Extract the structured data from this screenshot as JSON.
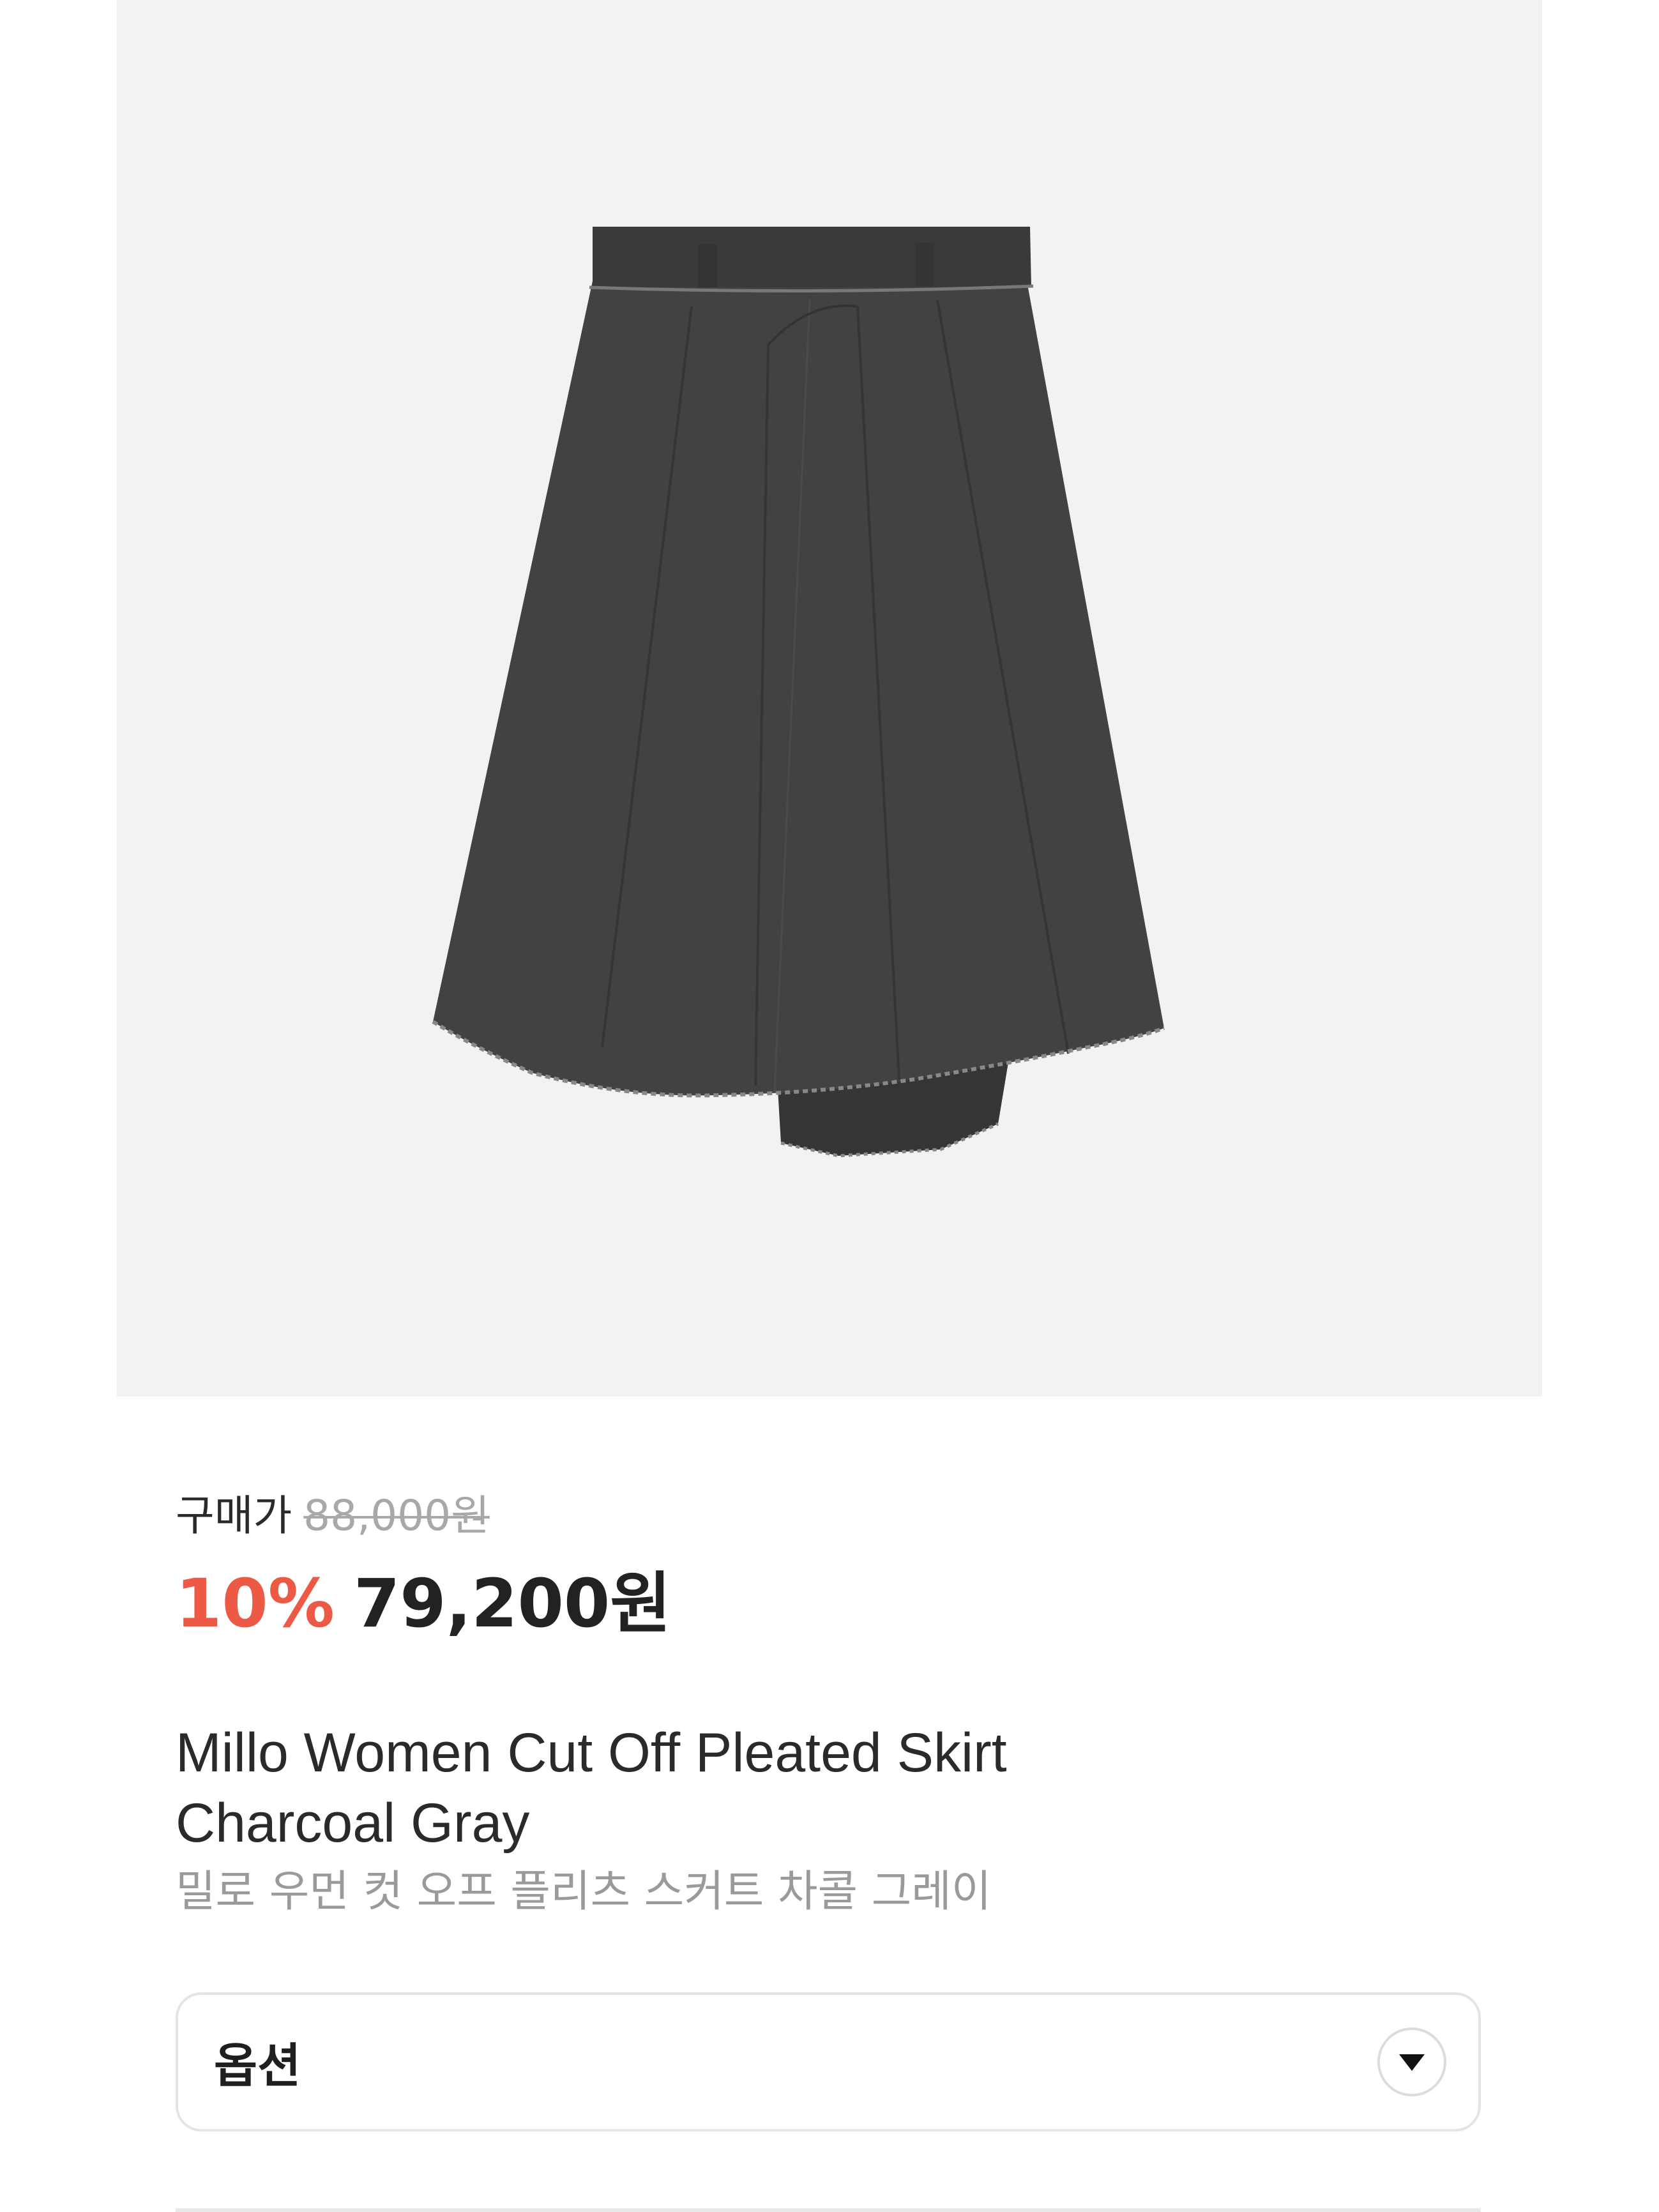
{
  "product_image": {
    "alt": "charcoal pleated skirt product photo",
    "background_color": "#f2f2f2",
    "garment_color": "#3f3e3d"
  },
  "price": {
    "label": "구매가",
    "original": "88,000원",
    "discount": "10%",
    "sale": "79,200원",
    "discount_color": "#ec5a45"
  },
  "product": {
    "name_en_line1": "Millo Women Cut Off Pleated Skirt",
    "name_en_line2": "Charcoal Gray",
    "name_ko": "밀로 우먼 컷 오프 플리츠 스커트 차콜 그레이"
  },
  "option": {
    "label": "옵션",
    "icon": "triangle-down-icon"
  }
}
